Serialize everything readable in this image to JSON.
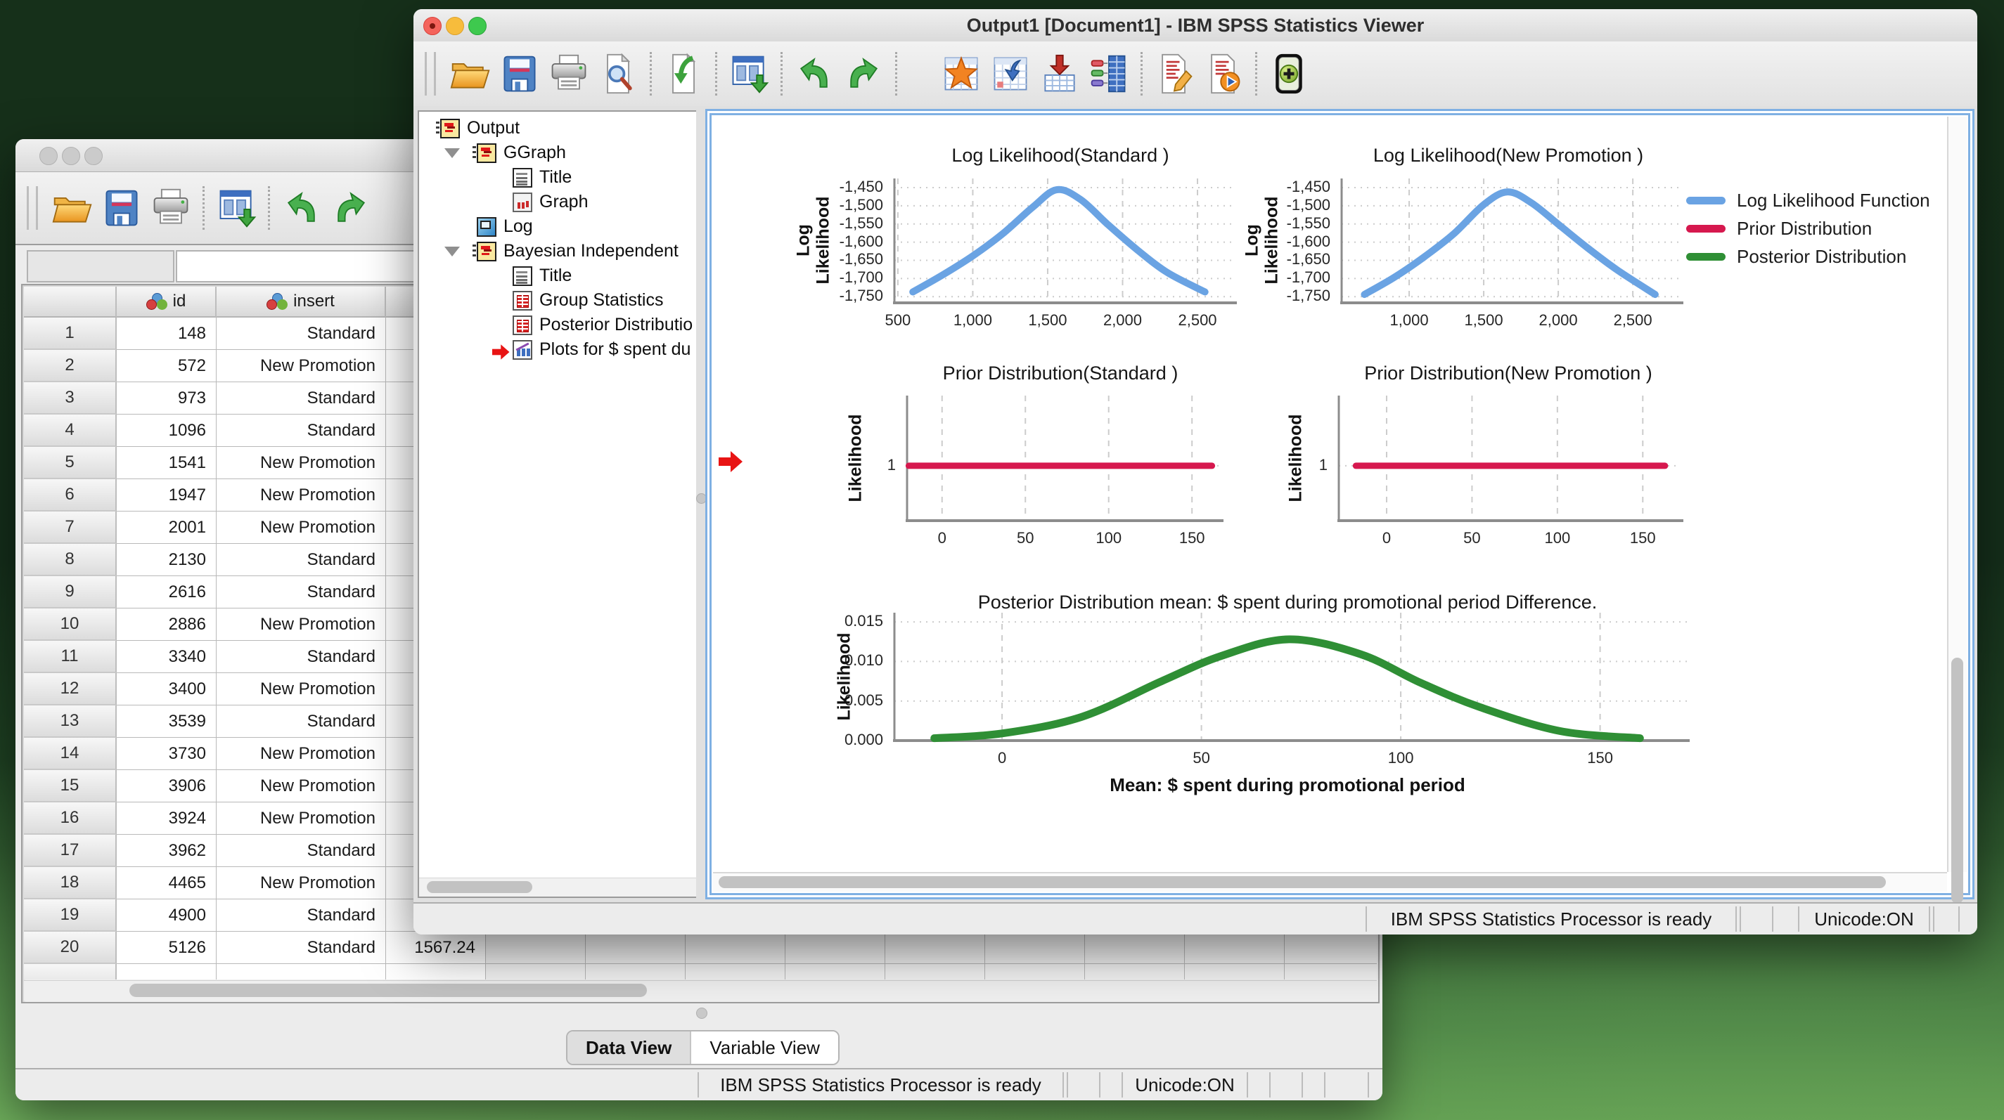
{
  "colors": {
    "likelihood_blue": "#6AA3E3",
    "prior_red": "#D6184E",
    "posterior_green": "#2F8F35",
    "focus_ring_blue": "#74A9DE",
    "desktop_green_dark": "#16321B",
    "desktop_green_light": "#5D9A4E"
  },
  "viewer_window": {
    "title": "Output1 [Document1] - IBM SPSS Statistics Viewer",
    "toolbar_groups": [
      [
        "open",
        "save",
        "print",
        "print-preview"
      ],
      [
        "export"
      ],
      [
        "recall-dialogs"
      ],
      [
        "undo",
        "redo"
      ],
      [
        "goto-case",
        "goto-variable",
        "insert-cases",
        "variables"
      ],
      [
        "edit-syntax",
        "run-script"
      ],
      [
        "show-all"
      ]
    ],
    "tree": {
      "items": [
        {
          "label": "Output",
          "icon": "notebook",
          "level": 0
        },
        {
          "label": "GGraph",
          "icon": "notebook",
          "level": 1,
          "expanded": true
        },
        {
          "label": "Title",
          "icon": "page",
          "level": 2
        },
        {
          "label": "Graph",
          "icon": "graph",
          "level": 2
        },
        {
          "label": "Log",
          "icon": "log",
          "level": 1
        },
        {
          "label": "Bayesian Independent",
          "icon": "notebook",
          "level": 1,
          "expanded": true
        },
        {
          "label": "Title",
          "icon": "page",
          "level": 2
        },
        {
          "label": "Group Statistics",
          "icon": "table",
          "level": 2
        },
        {
          "label": "Posterior Distributio",
          "icon": "table",
          "level": 2
        },
        {
          "label": "Plots for $ spent du",
          "icon": "plots",
          "level": 2,
          "selected": true
        }
      ]
    },
    "status_bar": {
      "processor": "IBM SPSS Statistics Processor is ready",
      "unicode": "Unicode:ON"
    }
  },
  "data_window": {
    "toolbar_groups": [
      [
        "open",
        "save",
        "print"
      ],
      [
        "recall-dialogs"
      ],
      [
        "undo",
        "redo"
      ]
    ],
    "cell_editor": {
      "reference": "",
      "value": ""
    },
    "table": {
      "columns": [
        {
          "label": "",
          "icon": "row-number"
        },
        {
          "label": "id",
          "icon": "nominal-measure-icon"
        },
        {
          "label": "insert",
          "icon": "nominal-measure-icon"
        },
        {
          "label": "",
          "icon": "scale-measure-icon"
        }
      ],
      "rows": [
        {
          "n": 1,
          "id": "148",
          "insert": "Standard",
          "col3": ""
        },
        {
          "n": 2,
          "id": "572",
          "insert": "New Promotion",
          "col3": ""
        },
        {
          "n": 3,
          "id": "973",
          "insert": "Standard",
          "col3": ""
        },
        {
          "n": 4,
          "id": "1096",
          "insert": "Standard",
          "col3": ""
        },
        {
          "n": 5,
          "id": "1541",
          "insert": "New Promotion",
          "col3": ""
        },
        {
          "n": 6,
          "id": "1947",
          "insert": "New Promotion",
          "col3": ""
        },
        {
          "n": 7,
          "id": "2001",
          "insert": "New Promotion",
          "col3": ""
        },
        {
          "n": 8,
          "id": "2130",
          "insert": "Standard",
          "col3": ""
        },
        {
          "n": 9,
          "id": "2616",
          "insert": "Standard",
          "col3": ""
        },
        {
          "n": 10,
          "id": "2886",
          "insert": "New Promotion",
          "col3": ""
        },
        {
          "n": 11,
          "id": "3340",
          "insert": "Standard",
          "col3": ""
        },
        {
          "n": 12,
          "id": "3400",
          "insert": "New Promotion",
          "col3": ""
        },
        {
          "n": 13,
          "id": "3539",
          "insert": "Standard",
          "col3": ""
        },
        {
          "n": 14,
          "id": "3730",
          "insert": "New Promotion",
          "col3": ""
        },
        {
          "n": 15,
          "id": "3906",
          "insert": "New Promotion",
          "col3": ""
        },
        {
          "n": 16,
          "id": "3924",
          "insert": "New Promotion",
          "col3": ""
        },
        {
          "n": 17,
          "id": "3962",
          "insert": "Standard",
          "col3": ""
        },
        {
          "n": 18,
          "id": "4465",
          "insert": "New Promotion",
          "col3": ""
        },
        {
          "n": 19,
          "id": "4900",
          "insert": "Standard",
          "col3": ""
        },
        {
          "n": 20,
          "id": "5126",
          "insert": "Standard",
          "col3": "1567.24"
        }
      ]
    },
    "view_tabs": [
      {
        "label": "Data View",
        "active": true
      },
      {
        "label": "Variable View",
        "active": false
      }
    ],
    "status_bar": {
      "processor": "IBM SPSS Statistics Processor is ready",
      "unicode": "Unicode:ON"
    }
  },
  "chart_data": {
    "legend": {
      "position": "right",
      "entries": [
        {
          "label": "Log Likelihood Function",
          "color": "#6AA3E3"
        },
        {
          "label": "Prior Distribution",
          "color": "#D6184E"
        },
        {
          "label": "Posterior Distribution",
          "color": "#2F8F35"
        }
      ]
    },
    "charts": [
      {
        "id": "loglik-standard",
        "type": "line",
        "title": "Log Likelihood(Standard )",
        "ylabel": "Log\nLikelihood",
        "xlabel": "",
        "grid": true,
        "xlim": [
          477,
          2697
        ],
        "ylim": [
          -1767,
          -1425
        ],
        "xticks": [
          {
            "v": 500,
            "label": "500"
          },
          {
            "v": 1000,
            "label": "1,000"
          },
          {
            "v": 1500,
            "label": "1,500"
          },
          {
            "v": 2000,
            "label": "2,000"
          },
          {
            "v": 2500,
            "label": "2,500"
          }
        ],
        "yticks": [
          {
            "v": -1450,
            "label": "-1,450"
          },
          {
            "v": -1500,
            "label": "-1,500"
          },
          {
            "v": -1550,
            "label": "-1,550"
          },
          {
            "v": -1600,
            "label": "-1,600"
          },
          {
            "v": -1650,
            "label": "-1,650"
          },
          {
            "v": -1700,
            "label": "-1,700"
          },
          {
            "v": -1750,
            "label": "-1,750"
          }
        ],
        "series": {
          "name": "Log Likelihood Function",
          "color_key": "likelihood_blue",
          "points": [
            [
              600,
              -1737
            ],
            [
              800,
              -1690
            ],
            [
              1000,
              -1638
            ],
            [
              1200,
              -1577
            ],
            [
              1400,
              -1504
            ],
            [
              1560,
              -1456
            ],
            [
              1720,
              -1483
            ],
            [
              1900,
              -1551
            ],
            [
              2100,
              -1622
            ],
            [
              2300,
              -1684
            ],
            [
              2550,
              -1737
            ]
          ]
        }
      },
      {
        "id": "loglik-new-promotion",
        "type": "line",
        "title": "Log Likelihood(New Promotion )",
        "ylabel": "Log\nLikelihood",
        "xlabel": "",
        "grid": true,
        "xlim": [
          547,
          2773
        ],
        "ylim": [
          -1767,
          -1425
        ],
        "xticks": [
          {
            "v": 1000,
            "label": "1,000"
          },
          {
            "v": 1500,
            "label": "1,500"
          },
          {
            "v": 2000,
            "label": "2,000"
          },
          {
            "v": 2500,
            "label": "2,500"
          }
        ],
        "yticks": [
          {
            "v": -1450,
            "label": "-1,450"
          },
          {
            "v": -1500,
            "label": "-1,500"
          },
          {
            "v": -1550,
            "label": "-1,550"
          },
          {
            "v": -1600,
            "label": "-1,600"
          },
          {
            "v": -1650,
            "label": "-1,650"
          },
          {
            "v": -1700,
            "label": "-1,700"
          },
          {
            "v": -1750,
            "label": "-1,750"
          }
        ],
        "series": {
          "name": "Log Likelihood Function",
          "color_key": "likelihood_blue",
          "points": [
            [
              700,
              -1744
            ],
            [
              900,
              -1697
            ],
            [
              1100,
              -1641
            ],
            [
              1300,
              -1577
            ],
            [
              1500,
              -1497
            ],
            [
              1660,
              -1462
            ],
            [
              1820,
              -1492
            ],
            [
              2000,
              -1551
            ],
            [
              2200,
              -1617
            ],
            [
              2400,
              -1678
            ],
            [
              2650,
              -1744
            ]
          ]
        }
      },
      {
        "id": "prior-standard",
        "type": "line",
        "title": "Prior Distribution(Standard )",
        "ylabel": "Likelihood",
        "xlabel": "",
        "grid": true,
        "xlim": [
          -21,
          163
        ],
        "ylim": [
          0,
          2.28
        ],
        "xticks": [
          {
            "v": 0,
            "label": "0"
          },
          {
            "v": 50,
            "label": "50"
          },
          {
            "v": 100,
            "label": "100"
          },
          {
            "v": 150,
            "label": "150"
          }
        ],
        "yticks": [
          {
            "v": 1,
            "label": "1"
          }
        ],
        "series": {
          "name": "Prior Distribution",
          "color_key": "prior_red",
          "points": [
            [
              -20,
              1
            ],
            [
              162,
              1
            ]
          ]
        }
      },
      {
        "id": "prior-new-promotion",
        "type": "line",
        "title": "Prior Distribution(New Promotion )",
        "ylabel": "Likelihood",
        "xlabel": "",
        "grid": true,
        "xlim": [
          -28,
          168
        ],
        "ylim": [
          0,
          2.28
        ],
        "xticks": [
          {
            "v": 0,
            "label": "0"
          },
          {
            "v": 50,
            "label": "50"
          },
          {
            "v": 100,
            "label": "100"
          },
          {
            "v": 150,
            "label": "150"
          }
        ],
        "yticks": [
          {
            "v": 1,
            "label": "1"
          }
        ],
        "series": {
          "name": "Prior Distribution",
          "color_key": "prior_red",
          "points": [
            [
              -18,
              1
            ],
            [
              163,
              1
            ]
          ]
        }
      },
      {
        "id": "posterior-difference",
        "type": "line",
        "title": "Posterior Distribution mean: $ spent during promotional period Difference.",
        "ylabel": "Likelihood",
        "xlabel": "Mean: $ spent during promotional period",
        "grid": true,
        "xlim": [
          -27,
          170
        ],
        "ylim": [
          0,
          0.01616
        ],
        "xticks": [
          {
            "v": 0,
            "label": "0"
          },
          {
            "v": 50,
            "label": "50"
          },
          {
            "v": 100,
            "label": "100"
          },
          {
            "v": 150,
            "label": "150"
          }
        ],
        "yticks": [
          {
            "v": 0,
            "label": "0.000"
          },
          {
            "v": 0.005,
            "label": "0.005"
          },
          {
            "v": 0.01,
            "label": "0.010"
          },
          {
            "v": 0.015,
            "label": "0.015"
          }
        ],
        "series": {
          "name": "Posterior Distribution",
          "color_key": "posterior_green",
          "points": [
            [
              -17,
              0.0003
            ],
            [
              0,
              0.0009
            ],
            [
              20,
              0.003
            ],
            [
              40,
              0.0075
            ],
            [
              55,
              0.0107
            ],
            [
              72,
              0.0128
            ],
            [
              90,
              0.0109
            ],
            [
              105,
              0.0073
            ],
            [
              120,
              0.0042
            ],
            [
              140,
              0.0012
            ],
            [
              160,
              0.0003
            ]
          ]
        }
      }
    ]
  }
}
